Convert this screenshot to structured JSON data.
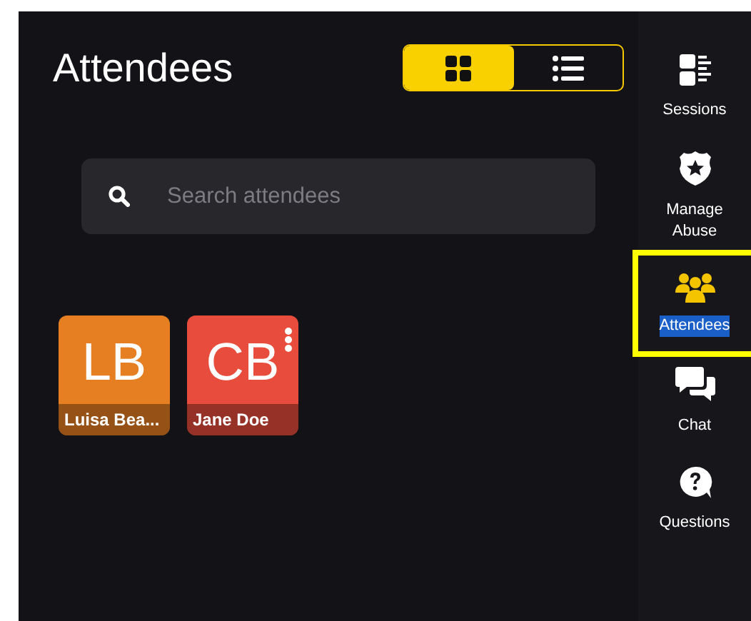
{
  "title": "Attendees",
  "view_toggle": [
    {
      "kind": "grid",
      "selected": true
    },
    {
      "kind": "list",
      "selected": false
    }
  ],
  "search": {
    "placeholder": "Search attendees"
  },
  "attendees": [
    {
      "initials": "LB",
      "name": "Luisa Bea...",
      "color": "#e67e22",
      "menu": false
    },
    {
      "initials": "CB",
      "name": "Jane Doe",
      "color": "#e74c3c",
      "menu": true
    }
  ],
  "sidebar": {
    "items": [
      {
        "label": "Sessions",
        "kind": "sessions",
        "selected": false,
        "highlighted": false
      },
      {
        "label": "Manage Abuse",
        "kind": "shield",
        "selected": false,
        "highlighted": false
      },
      {
        "label": "Attendees",
        "kind": "people",
        "selected": true,
        "highlighted": true
      },
      {
        "label": "Chat",
        "kind": "chat",
        "selected": false,
        "highlighted": false
      },
      {
        "label": "Questions",
        "kind": "question",
        "selected": false,
        "highlighted": false
      }
    ]
  }
}
